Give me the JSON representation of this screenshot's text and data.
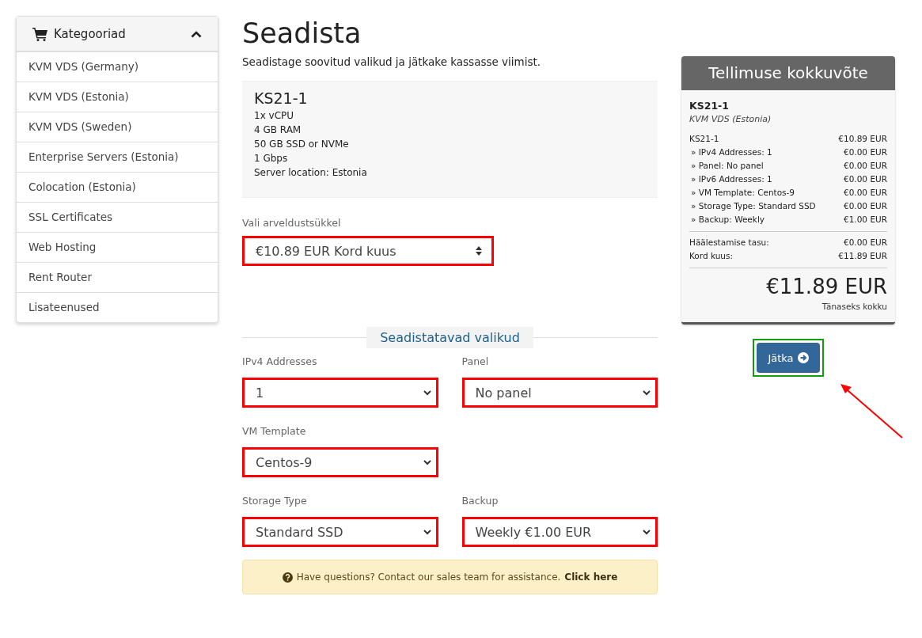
{
  "sidebar": {
    "title": "Kategooriad",
    "expanded": true,
    "items": [
      "KVM VDS (Germany)",
      "KVM VDS (Estonia)",
      "KVM VDS (Sweden)",
      "Enterprise Servers (Estonia)",
      "Colocation (Estonia)",
      "SSL Certificates",
      "Web Hosting",
      "Rent Router",
      "Lisateenused"
    ]
  },
  "page": {
    "title": "Seadista",
    "subtitle": "Seadistage soovitud valikud ja jätkake kassasse viimist."
  },
  "product": {
    "name": "KS21-1",
    "features": [
      "1x vCPU",
      "4 GB RAM",
      "50 GB SSD or NVMe",
      "1 Gbps",
      "Server location: Estonia"
    ]
  },
  "billing": {
    "label": "Vali arveldustsükkel",
    "value": "€10.89 EUR Kord kuus"
  },
  "options": {
    "heading": "Seadistatavad valikud",
    "rows": [
      [
        {
          "label": "IPv4 Addresses",
          "value": "1"
        },
        {
          "label": "Panel",
          "value": "No panel"
        }
      ],
      [
        {
          "label": "VM Template",
          "value": "Centos-9"
        }
      ],
      [
        {
          "label": "Storage Type",
          "value": "Standard SSD"
        },
        {
          "label": "Backup",
          "value": "Weekly €1.00 EUR"
        }
      ]
    ]
  },
  "help": {
    "text": "Have questions? Contact our sales team for assistance.",
    "link": "Click here"
  },
  "summary": {
    "title": "Tellimuse kokkuvõte",
    "product": "KS21-1",
    "group": "KVM VDS (Estonia)",
    "lines": [
      {
        "label": "KS21-1",
        "price": "€10.89 EUR",
        "kind": "main"
      },
      {
        "label": "» IPv4 Addresses: 1",
        "price": "€0.00 EUR",
        "kind": "sub"
      },
      {
        "label": "» Panel: No panel",
        "price": "€0.00 EUR",
        "kind": "sub"
      },
      {
        "label": "» IPv6 Addresses: 1",
        "price": "€0.00 EUR",
        "kind": "sub"
      },
      {
        "label": "» VM Template: Centos-9",
        "price": "€0.00 EUR",
        "kind": "sub"
      },
      {
        "label": "» Storage Type: Standard SSD",
        "price": "€0.00 EUR",
        "kind": "sub"
      },
      {
        "label": "» Backup: Weekly",
        "price": "€1.00 EUR",
        "kind": "sub"
      }
    ],
    "totals": [
      {
        "label": "Häälestamise tasu:",
        "price": "€0.00 EUR"
      },
      {
        "label": "Kord kuus:",
        "price": "€11.89 EUR"
      }
    ],
    "total": "€11.89 EUR",
    "total_label": "Tänaseks kokku"
  },
  "continue_button": "Jätka"
}
